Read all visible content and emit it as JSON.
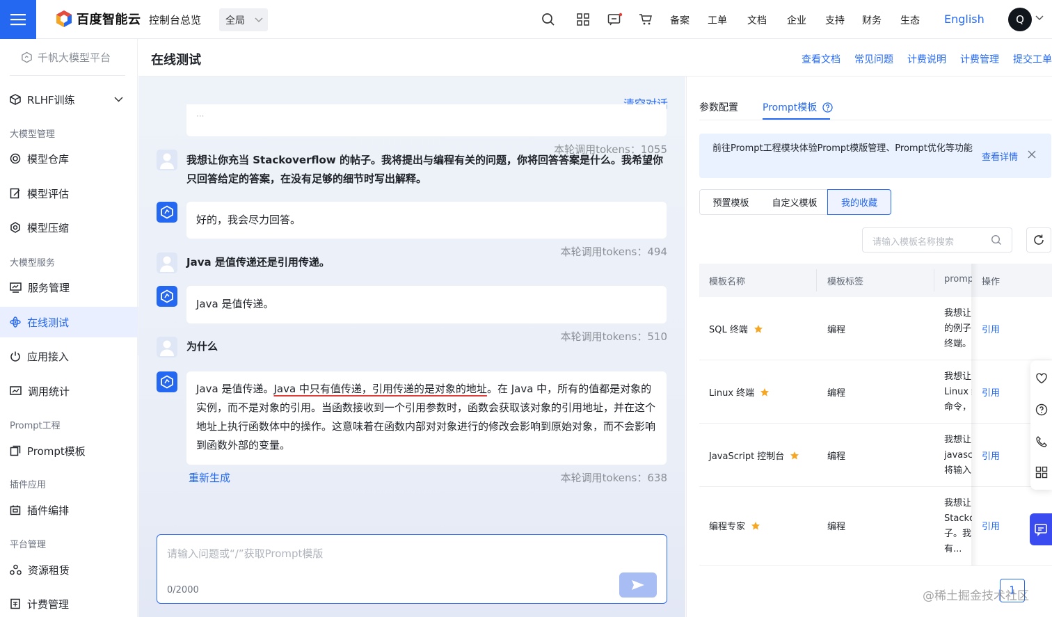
{
  "header": {
    "brand": "百度智能云",
    "console_link": "控制台总览",
    "scope": "全局",
    "nav": [
      "备案",
      "工单",
      "文档",
      "企业",
      "支持",
      "财务",
      "生态"
    ],
    "lang": "English",
    "avatar_initial": "Q"
  },
  "sidebar": {
    "platform": "千帆大模型平台",
    "rlhf": "RLHF训练",
    "groups": [
      "大模型管理",
      "大模型服务",
      "Prompt工程",
      "插件应用",
      "平台管理"
    ],
    "items": [
      "模型仓库",
      "模型评估",
      "模型压缩",
      "服务管理",
      "在线测试",
      "应用接入",
      "调用统计",
      "Prompt模板",
      "插件编排",
      "资源租赁",
      "计费管理"
    ],
    "active": "在线测试"
  },
  "page": {
    "title": "在线测试",
    "links": [
      "查看文档",
      "常见问题",
      "计费说明",
      "计费管理",
      "提交工单"
    ]
  },
  "chat": {
    "clear": "清空对话",
    "ellipsis": "···",
    "messages": [
      {
        "role": "user",
        "tokens": "本轮调用tokens：1055",
        "text": "我想让你充当 Stackoverflow 的帖子。我将提出与编程有关的问题，你将回答答案是什么。我希望你只回答给定的答案，在没有足够的细节时写出解释。"
      },
      {
        "role": "bot",
        "text": "好的，我会尽力回答。"
      },
      {
        "role": "user",
        "tokens": "本轮调用tokens：494",
        "text": "Java 是值传递还是引用传递。"
      },
      {
        "role": "bot",
        "text": "Java 是值传递。"
      },
      {
        "role": "user",
        "tokens": "本轮调用tokens：510",
        "text": "为什么"
      },
      {
        "role": "bot",
        "tokens": "本轮调用tokens：638",
        "text_a": "Java 是值传递。",
        "text_hl": "Java 中只有值传递，引用传递的是对象的地址",
        "text_b": "。在 Java 中，所有的值都是对象的实例，而不是对象的引用。当函数接收到一个引用参数时，函数会获取该对象的引用地址，并在这个地址上执行函数体中的操作。这意味着在函数内部对对象进行的修改会影响到原始对象，而不会影响到函数外部的变量。"
      }
    ],
    "regenerate": "重新生成",
    "input_placeholder": "请输入问题或“/”获取Prompt模版",
    "counter": "0/2000"
  },
  "panel": {
    "tabs": [
      "参数配置",
      "Prompt模板"
    ],
    "active_tab": "Prompt模板",
    "notice": "前往Prompt工程模块体验Prompt模版管理、Prompt优化等功能",
    "notice_link": "查看详情",
    "segments": [
      "预置模板",
      "自定义模板",
      "我的收藏"
    ],
    "active_segment": "我的收藏",
    "search_placeholder": "请输入模板名称搜索",
    "columns": [
      "模板名称",
      "模板标签",
      "prompt",
      "操作"
    ],
    "rows": [
      {
        "name": "SQL 终端",
        "tag": "编程",
        "prompt": [
          "我想让",
          "的例子",
          "终端。"
        ],
        "action": "引用"
      },
      {
        "name": "Linux 终端",
        "tag": "编程",
        "prompt": [
          "我想让",
          "Linux 终",
          "命令，"
        ],
        "action": "引用"
      },
      {
        "name": "JavaScript 控制台",
        "tag": "编程",
        "prompt": [
          "我想让",
          "javasc",
          "将输入"
        ],
        "action": "引用"
      },
      {
        "name": "编程专家",
        "tag": "编程",
        "prompt": [
          "我想让",
          "Stackc",
          "子。我",
          "有..."
        ],
        "action": "引用"
      }
    ],
    "page_number": "1"
  },
  "watermark": "@稀土掘金技术社区",
  "colors": {
    "accent": "#2468f2",
    "star": "#f5a623",
    "highlight_underline": "#e23c39"
  }
}
